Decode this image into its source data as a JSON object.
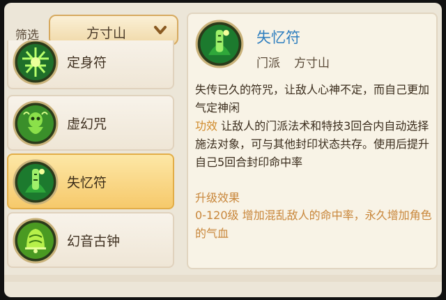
{
  "filter": {
    "label": "筛选",
    "value": "方寸山"
  },
  "list": [
    {
      "name": "定身符"
    },
    {
      "name": "虚幻咒"
    },
    {
      "name": "失忆符",
      "selected": true
    },
    {
      "name": "幻音古钟"
    }
  ],
  "detail": {
    "name": "失忆符",
    "sect_label": "门派",
    "sect_value": "方寸山",
    "desc_line": "失传已久的符咒，让敌人心神不定，而自己更加气定神闲",
    "effect_key": "功效",
    "effect_text": " 让敌人的门派法术和特技3回合内自动选择施法对象，可与其他封印状态共存。使用后提升自己5回合封印命中率",
    "upgrade_title": "升级效果",
    "upgrade_text": "0-120级 增加混乱敌人的命中率，永久增加角色的气血"
  },
  "colors": {
    "skill_name": "#2f7fbf",
    "highlight_orange": "#d08a2a",
    "selected_row": "#f6c96b",
    "icon_green": "#3fbf3a"
  },
  "icons": [
    "chevron-down-icon",
    "talisman-icon",
    "ghost-spell-icon",
    "amnesia-talisman-icon",
    "ancient-bell-icon"
  ]
}
